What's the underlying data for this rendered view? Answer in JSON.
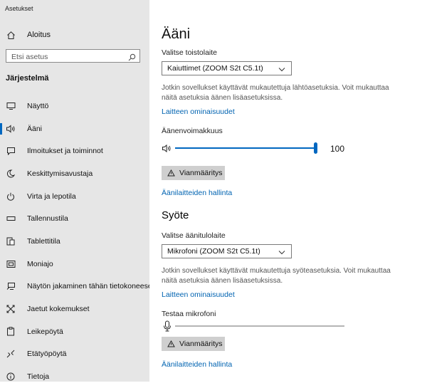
{
  "window": {
    "title": "Asetukset"
  },
  "sidebar": {
    "home_label": "Aloitus",
    "search_placeholder": "Etsi asetus",
    "section_label": "Järjestelmä",
    "items": [
      {
        "label": "Näyttö",
        "icon": "monitor-icon"
      },
      {
        "label": "Ääni",
        "icon": "speaker-icon",
        "active": true
      },
      {
        "label": "Ilmoitukset ja toiminnot",
        "icon": "notification-icon"
      },
      {
        "label": "Keskittymisavustaja",
        "icon": "moon-icon"
      },
      {
        "label": "Virta ja lepotila",
        "icon": "power-icon"
      },
      {
        "label": "Tallennustila",
        "icon": "storage-icon"
      },
      {
        "label": "Tablettitila",
        "icon": "tablet-icon"
      },
      {
        "label": "Moniajo",
        "icon": "multitasking-icon"
      },
      {
        "label": "Näytön jakaminen tähän tietokoneeseen",
        "icon": "projecting-icon"
      },
      {
        "label": "Jaetut kokemukset",
        "icon": "shared-experiences-icon"
      },
      {
        "label": "Leikepöytä",
        "icon": "clipboard-icon"
      },
      {
        "label": "Etätyöpöytä",
        "icon": "remote-desktop-icon"
      },
      {
        "label": "Tietoja",
        "icon": "info-icon"
      }
    ]
  },
  "main": {
    "title": "Ääni",
    "output": {
      "device_label": "Valitse toistolaite",
      "device_value": "Kaiuttimet (ZOOM S2t C5.1t)",
      "description": "Jotkin sovellukset käyttävät mukautettuja lähtöasetuksia. Voit mukauttaa näitä asetuksia äänen lisäasetuksissa.",
      "properties_link": "Laitteen ominaisuudet",
      "volume_label": "Äänenvoimakkuus",
      "volume_value": "100",
      "volume_level": 1.0,
      "troubleshoot_label": "Vianmääritys",
      "manage_link": "Äänilaitteiden hallinta"
    },
    "input": {
      "heading": "Syöte",
      "device_label": "Valitse äänitulolaite",
      "device_value": "Mikrofoni (ZOOM S2t C5.1t)",
      "description": "Jotkin sovellukset käyttävät mukautettuja syöteasetuksia. Voit mukauttaa näitä asetuksia äänen lisäasetuksissa.",
      "properties_link": "Laitteen ominaisuudet",
      "test_label": "Testaa mikrofoni",
      "mic_level": 0.0,
      "troubleshoot_label": "Vianmääritys",
      "manage_link": "Äänilaitteiden hallinta"
    }
  },
  "colors": {
    "accent": "#0067c0",
    "link": "#0063b1",
    "sidebar_bg": "#e6e6e6",
    "button_bg": "#cfcfcf"
  }
}
